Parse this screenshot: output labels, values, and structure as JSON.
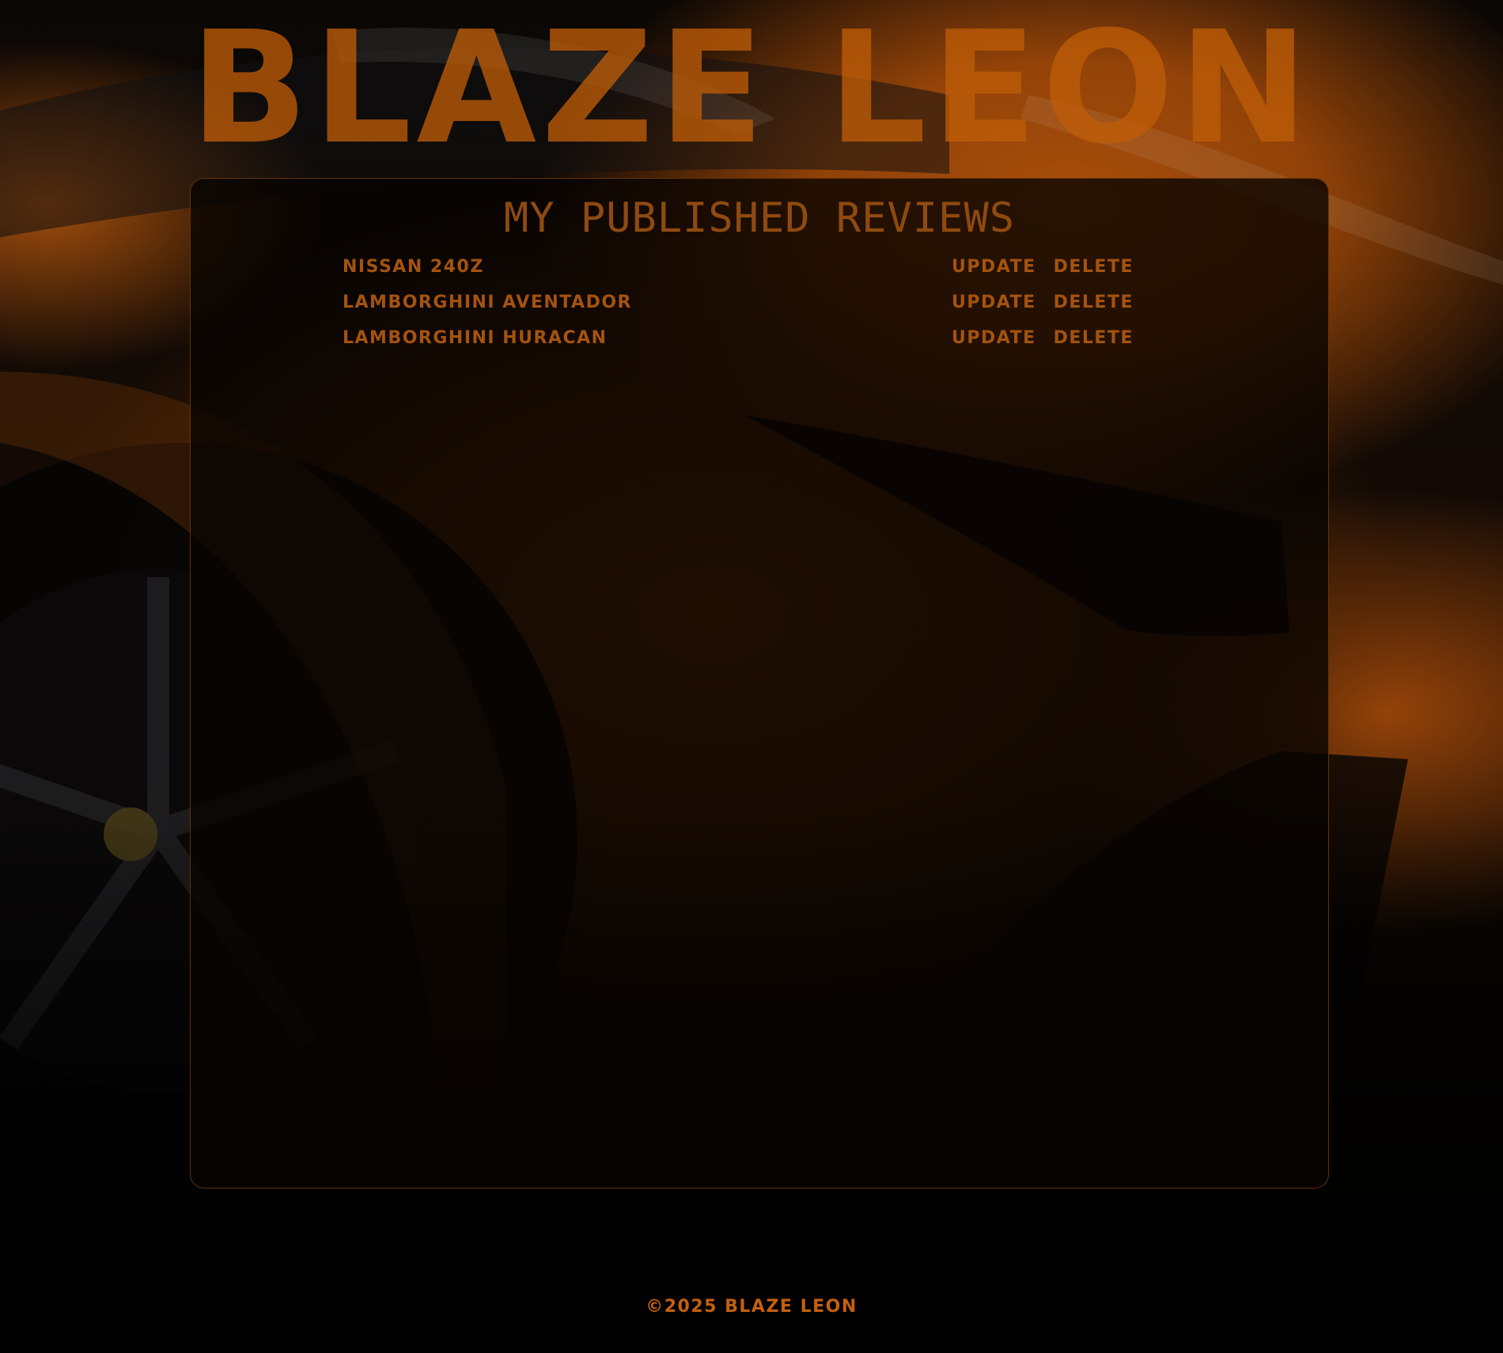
{
  "brand": {
    "logo_text": "BLAZE LEON"
  },
  "panel": {
    "title": "MY PUBLISHED REVIEWS"
  },
  "reviews": [
    {
      "name": "NISSAN 240Z",
      "update_label": "UPDATE",
      "delete_label": "DELETE"
    },
    {
      "name": "LAMBORGHINI AVENTADOR",
      "update_label": "UPDATE",
      "delete_label": "DELETE"
    },
    {
      "name": "LAMBORGHINI HURACAN",
      "update_label": "UPDATE",
      "delete_label": "DELETE"
    }
  ],
  "footer": {
    "copyright": "©2025 BLAZE LEON"
  },
  "colors": {
    "accent": "#c4600e",
    "accent_dim": "#a4530f",
    "background": "#020100"
  },
  "background_image": {
    "subject": "orange-supercar-photo"
  }
}
